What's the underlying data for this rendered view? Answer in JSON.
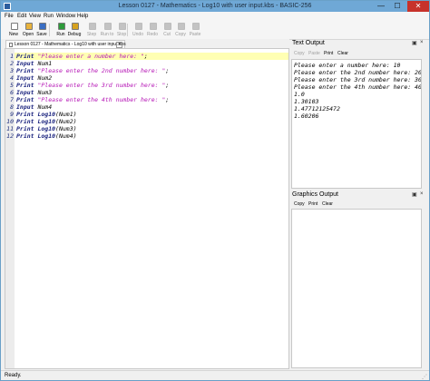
{
  "window": {
    "title": "Lesson 0127 - Mathematics - Log10 with user input.kbs - BASIC-256",
    "min": "—",
    "max": "☐",
    "close": "✕"
  },
  "menu": [
    "File",
    "Edit",
    "View",
    "Run",
    "Window",
    "Help"
  ],
  "toolbar": [
    {
      "label": "New",
      "icon": "new-file-icon",
      "color": "#ffffff",
      "enabled": true
    },
    {
      "label": "Open",
      "icon": "open-folder-icon",
      "color": "#e8b23c",
      "enabled": true
    },
    {
      "label": "Save",
      "icon": "save-disk-icon",
      "color": "#3b6fc4",
      "enabled": true
    },
    {
      "label": "Run",
      "icon": "run-icon",
      "color": "#2e9b3a",
      "enabled": true
    },
    {
      "label": "Debug",
      "icon": "debug-icon",
      "color": "#d7a21f",
      "enabled": true
    },
    {
      "label": "Step",
      "icon": "step-icon",
      "color": "#888888",
      "enabled": false
    },
    {
      "label": "Run to",
      "icon": "run-to-icon",
      "color": "#888888",
      "enabled": false
    },
    {
      "label": "Stop",
      "icon": "stop-icon",
      "color": "#888888",
      "enabled": false
    },
    {
      "label": "Undo",
      "icon": "undo-icon",
      "color": "#888888",
      "enabled": false
    },
    {
      "label": "Redo",
      "icon": "redo-icon",
      "color": "#888888",
      "enabled": false
    },
    {
      "label": "Cut",
      "icon": "cut-icon",
      "color": "#888888",
      "enabled": false
    },
    {
      "label": "Copy",
      "icon": "copy-icon",
      "color": "#888888",
      "enabled": false
    },
    {
      "label": "Paste",
      "icon": "paste-icon",
      "color": "#888888",
      "enabled": false
    }
  ],
  "tab": {
    "label": "Lesson 0127 - Mathematics - Log10 with user input.kbs",
    "close": "×"
  },
  "code": [
    {
      "n": "1",
      "tokens": [
        {
          "t": "Print ",
          "c": "kw"
        },
        {
          "t": "\"Please enter a number here: \"",
          "c": "str"
        },
        {
          "t": ";",
          "c": "id"
        }
      ]
    },
    {
      "n": "2",
      "tokens": [
        {
          "t": "Input ",
          "c": "kw"
        },
        {
          "t": "Num1",
          "c": "id"
        }
      ]
    },
    {
      "n": "3",
      "tokens": [
        {
          "t": "Print ",
          "c": "kw"
        },
        {
          "t": "\"Please enter the 2nd number here: \"",
          "c": "str"
        },
        {
          "t": ";",
          "c": "id"
        }
      ]
    },
    {
      "n": "4",
      "tokens": [
        {
          "t": "Input ",
          "c": "kw"
        },
        {
          "t": "Num2",
          "c": "id"
        }
      ]
    },
    {
      "n": "5",
      "tokens": [
        {
          "t": "Print ",
          "c": "kw"
        },
        {
          "t": "\"Please enter the 3rd number here: \"",
          "c": "str"
        },
        {
          "t": ";",
          "c": "id"
        }
      ]
    },
    {
      "n": "6",
      "tokens": [
        {
          "t": "Input ",
          "c": "kw"
        },
        {
          "t": "Num3",
          "c": "id"
        }
      ]
    },
    {
      "n": "7",
      "tokens": [
        {
          "t": "Print ",
          "c": "kw"
        },
        {
          "t": "\"Please enter the 4th number here: \"",
          "c": "str"
        },
        {
          "t": ";",
          "c": "id"
        }
      ]
    },
    {
      "n": "8",
      "tokens": [
        {
          "t": "Input ",
          "c": "kw"
        },
        {
          "t": "Num4",
          "c": "id"
        }
      ]
    },
    {
      "n": "9",
      "tokens": [
        {
          "t": "Print ",
          "c": "kw"
        },
        {
          "t": "Log10",
          "c": "kw"
        },
        {
          "t": "(Num1)",
          "c": "id"
        }
      ]
    },
    {
      "n": "10",
      "tokens": [
        {
          "t": "Print ",
          "c": "kw"
        },
        {
          "t": "Log10",
          "c": "kw"
        },
        {
          "t": "(Num2)",
          "c": "id"
        }
      ]
    },
    {
      "n": "11",
      "tokens": [
        {
          "t": "Print ",
          "c": "kw"
        },
        {
          "t": "Log10",
          "c": "kw"
        },
        {
          "t": "(Num3)",
          "c": "id"
        }
      ]
    },
    {
      "n": "12",
      "tokens": [
        {
          "t": "Print ",
          "c": "kw"
        },
        {
          "t": "Log10",
          "c": "kw"
        },
        {
          "t": "(Num4)",
          "c": "id"
        }
      ]
    }
  ],
  "text_output": {
    "title": "Text Output",
    "buttons": [
      {
        "label": "Copy",
        "enabled": false
      },
      {
        "label": "Paste",
        "enabled": false
      },
      {
        "label": "Print",
        "enabled": true
      },
      {
        "label": "Clear",
        "enabled": true
      }
    ],
    "lines": [
      "Please enter a number here: 10",
      "Please enter the 2nd number here: 20",
      "Please enter the 3rd number here: 30",
      "Please enter the 4th number here: 40",
      "1.0",
      "1.30103",
      "1.47712125472",
      "1.60206"
    ]
  },
  "graphics_output": {
    "title": "Graphics Output",
    "buttons": [
      {
        "label": "Copy",
        "enabled": true
      },
      {
        "label": "Print",
        "enabled": true
      },
      {
        "label": "Clear",
        "enabled": true
      }
    ]
  },
  "panel_controls": {
    "float": "▣",
    "close": "×"
  },
  "status": "Ready."
}
